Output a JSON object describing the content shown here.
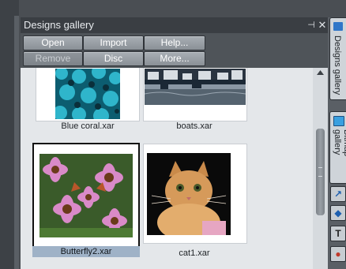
{
  "gallery": {
    "title": "Designs gallery",
    "buttons": {
      "open": "Open",
      "import": "Import",
      "help": "Help...",
      "remove": "Remove",
      "disc_designs": "Disc designs...",
      "more": "More..."
    },
    "items": [
      {
        "caption": "Blue coral.xar",
        "selected": false
      },
      {
        "caption": "boats.xar",
        "selected": false
      },
      {
        "caption": "Butterfly2.xar",
        "selected": true
      },
      {
        "caption": "cat1.xar",
        "selected": false
      }
    ]
  },
  "right_tabs": {
    "designs_gallery": "Designs gallery",
    "bitmap_gallery": "Bitmap gallery"
  },
  "icons": [
    "pin-icon",
    "close-icon",
    "scroll-up-arrow-icon",
    "designs-gallery-icon",
    "bitmap-gallery-icon",
    "blend-tool-icon",
    "fill-tool-icon",
    "text-tool-icon",
    "color-icon"
  ],
  "colors": {
    "accent_blue": "#1d5fb0",
    "selected_caption": "#9fb2c7"
  }
}
